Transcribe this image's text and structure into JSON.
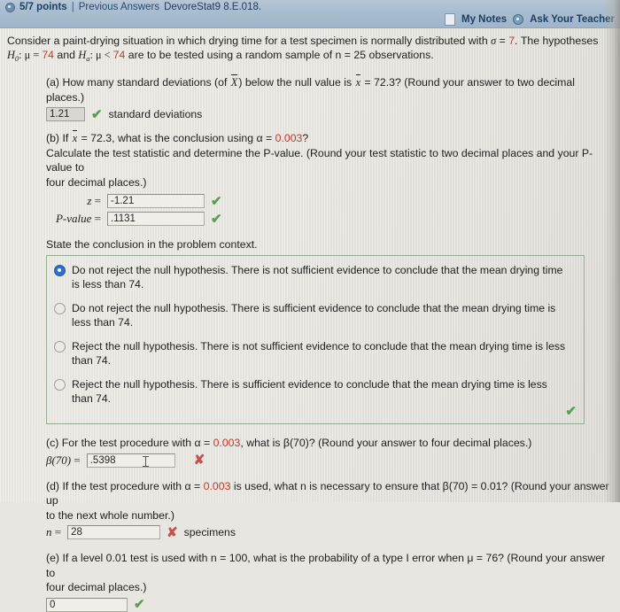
{
  "header": {
    "points": "5/7 points",
    "separator": "|",
    "previous_answers": "Previous Answers",
    "question_id": "DevoreStat9 8.E.018.",
    "my_notes": "My Notes",
    "ask_your_teacher": "Ask Your Teacher",
    "bar_color": "#aabdd0",
    "link_color": "#1d3f63"
  },
  "problem": {
    "stem_part1": "Consider a paint-drying situation in which drying time for a test specimen is normally distributed with ",
    "sigma_symbol": "σ",
    "equals": " = ",
    "sigma_value": "7",
    "stem_part2": ". The hypotheses ",
    "h0_symbol": "H",
    "h0_sub": "0",
    "h0_text": ": μ = ",
    "h0_value": "74",
    "and_text": " and ",
    "ha_symbol": "H",
    "ha_sub": "a",
    "ha_text": ": μ < ",
    "ha_value": "74",
    "stem_part3": " are to be tested using a random sample of n = 25 observations."
  },
  "parts": {
    "a": {
      "label": "(a)",
      "question": "How many standard deviations (of X) below the null value is x = 72.3? (Round your answer to two decimal places.)",
      "q_prefix": "How many standard deviations (of ",
      "q_mid": ") below the null value is ",
      "q_suffix": " = 72.3? (Round your answer to two decimal places.)",
      "answer_value": "1.21",
      "unit": "standard deviations",
      "status": "correct",
      "status_mark": "✔"
    },
    "b": {
      "label": "(b)",
      "q_prefix": "If ",
      "q_mid": " = 72.3, what is the conclusion using α = ",
      "alpha_value": "0.003",
      "q_suffix": "?",
      "line2": "Calculate the test statistic and determine the P-value. (Round your test statistic to two decimal places and your P-value to",
      "line3": "four decimal places.)",
      "z_label": "z",
      "z_value": "-1.21",
      "z_status_mark": "✔",
      "p_label": "P-value",
      "p_value": ".1131",
      "p_status_mark": "✔",
      "conclusion_prompt": "State the conclusion in the problem context.",
      "options": [
        {
          "text": "Do not reject the null hypothesis. There is not sufficient evidence to conclude that the mean drying time is less than 74.",
          "selected": true
        },
        {
          "text": "Do not reject the null hypothesis. There is sufficient evidence to conclude that the mean drying time is less than 74.",
          "selected": false
        },
        {
          "text": "Reject the null hypothesis. There is not sufficient evidence to conclude that the mean drying time is less than 74.",
          "selected": false
        },
        {
          "text": "Reject the null hypothesis. There is sufficient evidence to conclude that the mean drying time is less than 74.",
          "selected": false
        }
      ],
      "group_status_mark": "✔"
    },
    "c": {
      "label": "(c)",
      "q_prefix": "For the test procedure with α = ",
      "alpha_value": "0.003",
      "q_suffix": ", what is β(70)? (Round your answer to four decimal places.)",
      "answer_label": "β(70)",
      "answer_value": ".5398",
      "status": "incorrect",
      "status_mark": "✘"
    },
    "d": {
      "label": "(d)",
      "q_prefix": "If the test procedure with α = ",
      "alpha_value": "0.003",
      "q_mid": " is used, what n is necessary to ensure that β(70) = 0.01? (Round your answer up",
      "line2": "to the next whole number.)",
      "answer_label": "n",
      "answer_value": "28",
      "unit": "specimens",
      "status": "incorrect",
      "status_mark": "✘"
    },
    "e": {
      "label": "(e)",
      "q_prefix": "If a level 0.01 test is used with n = 100, what is the probability of a type I error when μ = 76? (Round your answer to",
      "line2": "four decimal places.)",
      "answer_value": "0",
      "status": "correct",
      "status_mark": "✔"
    }
  },
  "colors": {
    "highlight_red": "#c0392b",
    "correct_green": "#5c9d54",
    "incorrect_red": "#c94f4f",
    "radio_selected_blue": "#2f6fd0"
  }
}
